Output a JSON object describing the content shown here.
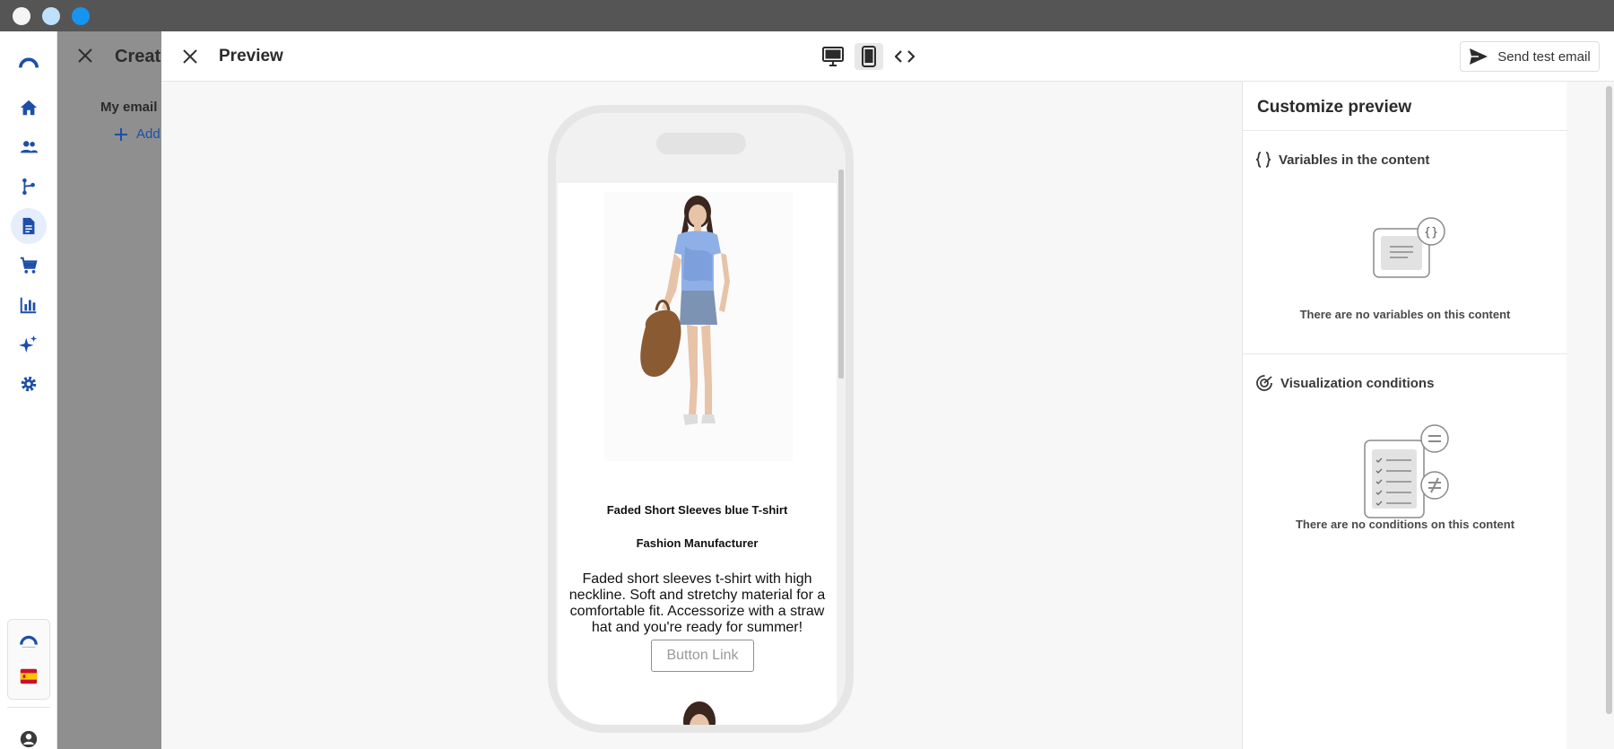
{
  "window": {
    "dots": [
      "#f5f5f5",
      "#bfe0fb",
      "#1793f0"
    ]
  },
  "nav": {
    "items": [
      {
        "icon": "home-icon"
      },
      {
        "icon": "contacts-icon"
      },
      {
        "icon": "automation-icon"
      },
      {
        "icon": "content-icon",
        "active": true
      },
      {
        "icon": "cart-icon"
      },
      {
        "icon": "analytics-icon"
      },
      {
        "icon": "ai-sparkle-icon"
      },
      {
        "icon": "settings-icon"
      }
    ],
    "bottom": [
      {
        "icon": "brand-logo-icon"
      },
      {
        "icon": "spain-flag-icon"
      },
      {
        "icon": "account-icon"
      }
    ]
  },
  "background_editor": {
    "title": "Create",
    "subtitle": "My email",
    "add_label": "Add"
  },
  "preview": {
    "title": "Preview",
    "view_modes": [
      "desktop-view",
      "mobile-view",
      "code-view"
    ],
    "active_view": "mobile-view",
    "send_test_label": "Send test email"
  },
  "email": {
    "product_title": "Faded Short Sleeves blue T-shirt",
    "manufacturer": "Fashion Manufacturer",
    "description": "Faded short sleeves t-shirt with high neckline. Soft and stretchy material for a comfortable fit. Accessorize with a straw hat and you're ready for summer!",
    "button_label": "Button Link"
  },
  "customize": {
    "title": "Customize preview",
    "variables_heading": "Variables in the content",
    "variables_empty": "There are no variables on this content",
    "conditions_heading": "Visualization conditions",
    "conditions_empty": "There are no conditions on this content"
  },
  "colors": {
    "accent": "#1d4fa8",
    "nav_active_bg": "#e6edfb",
    "overlay": "#8f8f8f"
  }
}
